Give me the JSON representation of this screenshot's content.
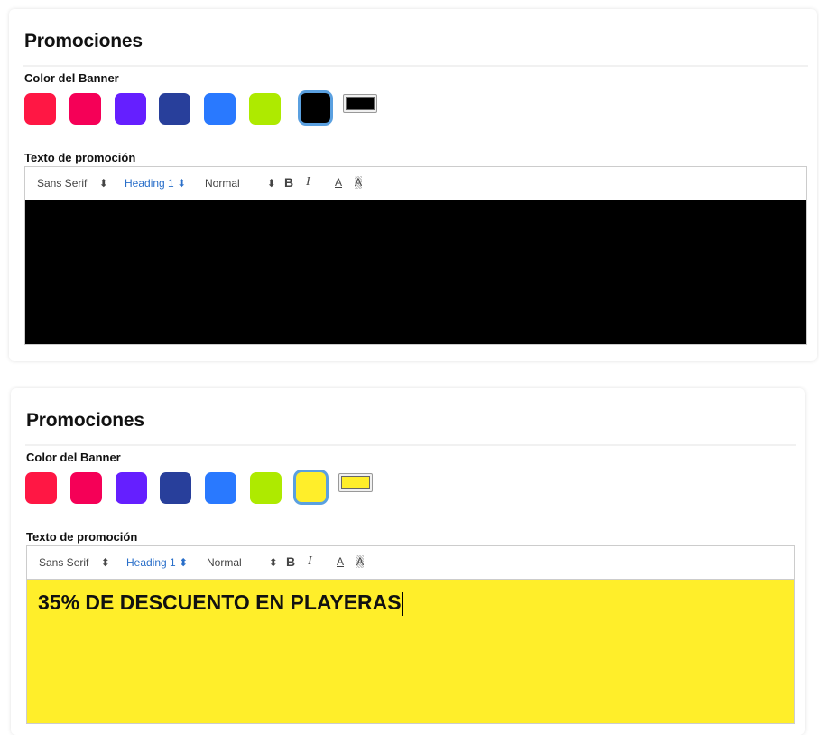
{
  "panels": [
    {
      "title": "Promociones",
      "color_label": "Color del Banner",
      "text_label": "Texto de promoción",
      "selected_color": "#000000",
      "editor_text": ""
    },
    {
      "title": "Promociones",
      "color_label": "Color del Banner",
      "text_label": "Texto de promoción",
      "selected_color": "#ffee2a",
      "editor_text": "35% DE DESCUENTO EN PLAYERAS"
    }
  ],
  "swatches": [
    "#ff1744",
    "#f50057",
    "#651fff",
    "#283f9b",
    "#2979ff",
    "#aeea00"
  ],
  "toolbar": {
    "font": "Sans Serif",
    "header": "Heading 1",
    "size": "Normal",
    "bold": "B",
    "italic": "I",
    "color": "A",
    "background": "A",
    "arrows": "⬍"
  }
}
